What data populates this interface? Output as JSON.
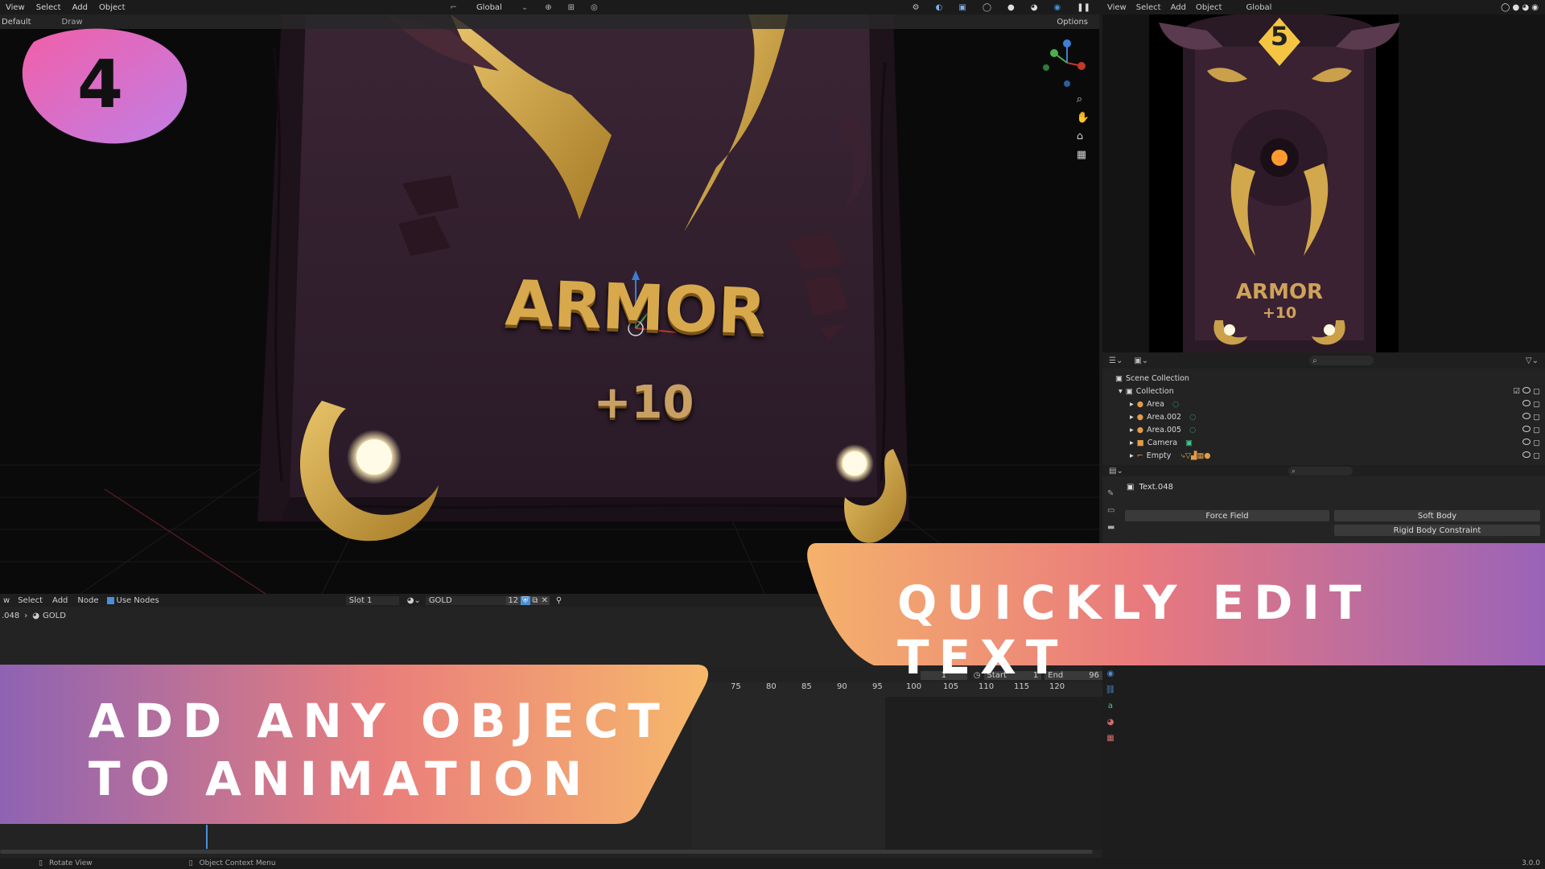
{
  "badge": {
    "number": "4"
  },
  "top_menu": {
    "items": [
      "View",
      "Select",
      "Add",
      "Object"
    ],
    "transform": "Global",
    "right_menu": [
      "View",
      "Select",
      "Add",
      "Object"
    ],
    "right_transform": "Global"
  },
  "sub_header": {
    "layout": "Default",
    "draw": "Draw",
    "options": "Options"
  },
  "viewport": {
    "card_title": "ARMOR",
    "card_value": "+10"
  },
  "camera_view": {
    "cost": "5",
    "card_title": "ARMOR",
    "card_value": "+10"
  },
  "outliner": {
    "scene_collection": "Scene Collection",
    "collection": "Collection",
    "items": [
      "Area",
      "Area.002",
      "Area.005",
      "Camera",
      "Empty"
    ]
  },
  "properties": {
    "object_name": "Text.048",
    "force_field": "Force Field",
    "soft_body": "Soft Body",
    "rigid_body_constraint": "Rigid Body Constraint"
  },
  "node_editor": {
    "menu": [
      "w",
      "Select",
      "Add",
      "Node"
    ],
    "use_nodes": "Use Nodes",
    "slot": "Slot 1",
    "material": "GOLD",
    "users": "12",
    "breadcrumb_obj": ".048",
    "breadcrumb_mat": "GOLD"
  },
  "timeline": {
    "current_frame": "1",
    "start_label": "Start",
    "start_value": "1",
    "end_label": "End",
    "end_value": "96",
    "ticks": [
      "75",
      "80",
      "85",
      "90",
      "95",
      "100",
      "105",
      "110",
      "115",
      "120"
    ]
  },
  "status_bar": {
    "rotate": "Rotate View",
    "context": "Object Context Menu",
    "version": "3.0.0"
  },
  "banner_right": {
    "text": "QUICKLY EDIT TEXT"
  },
  "banner_left": {
    "line1": "ADD ANY OBJECT",
    "line2": "TO ANIMATION"
  },
  "colors": {
    "gold": "#d6a640",
    "card": "#3a2331",
    "accent": "#4a8fd8"
  }
}
